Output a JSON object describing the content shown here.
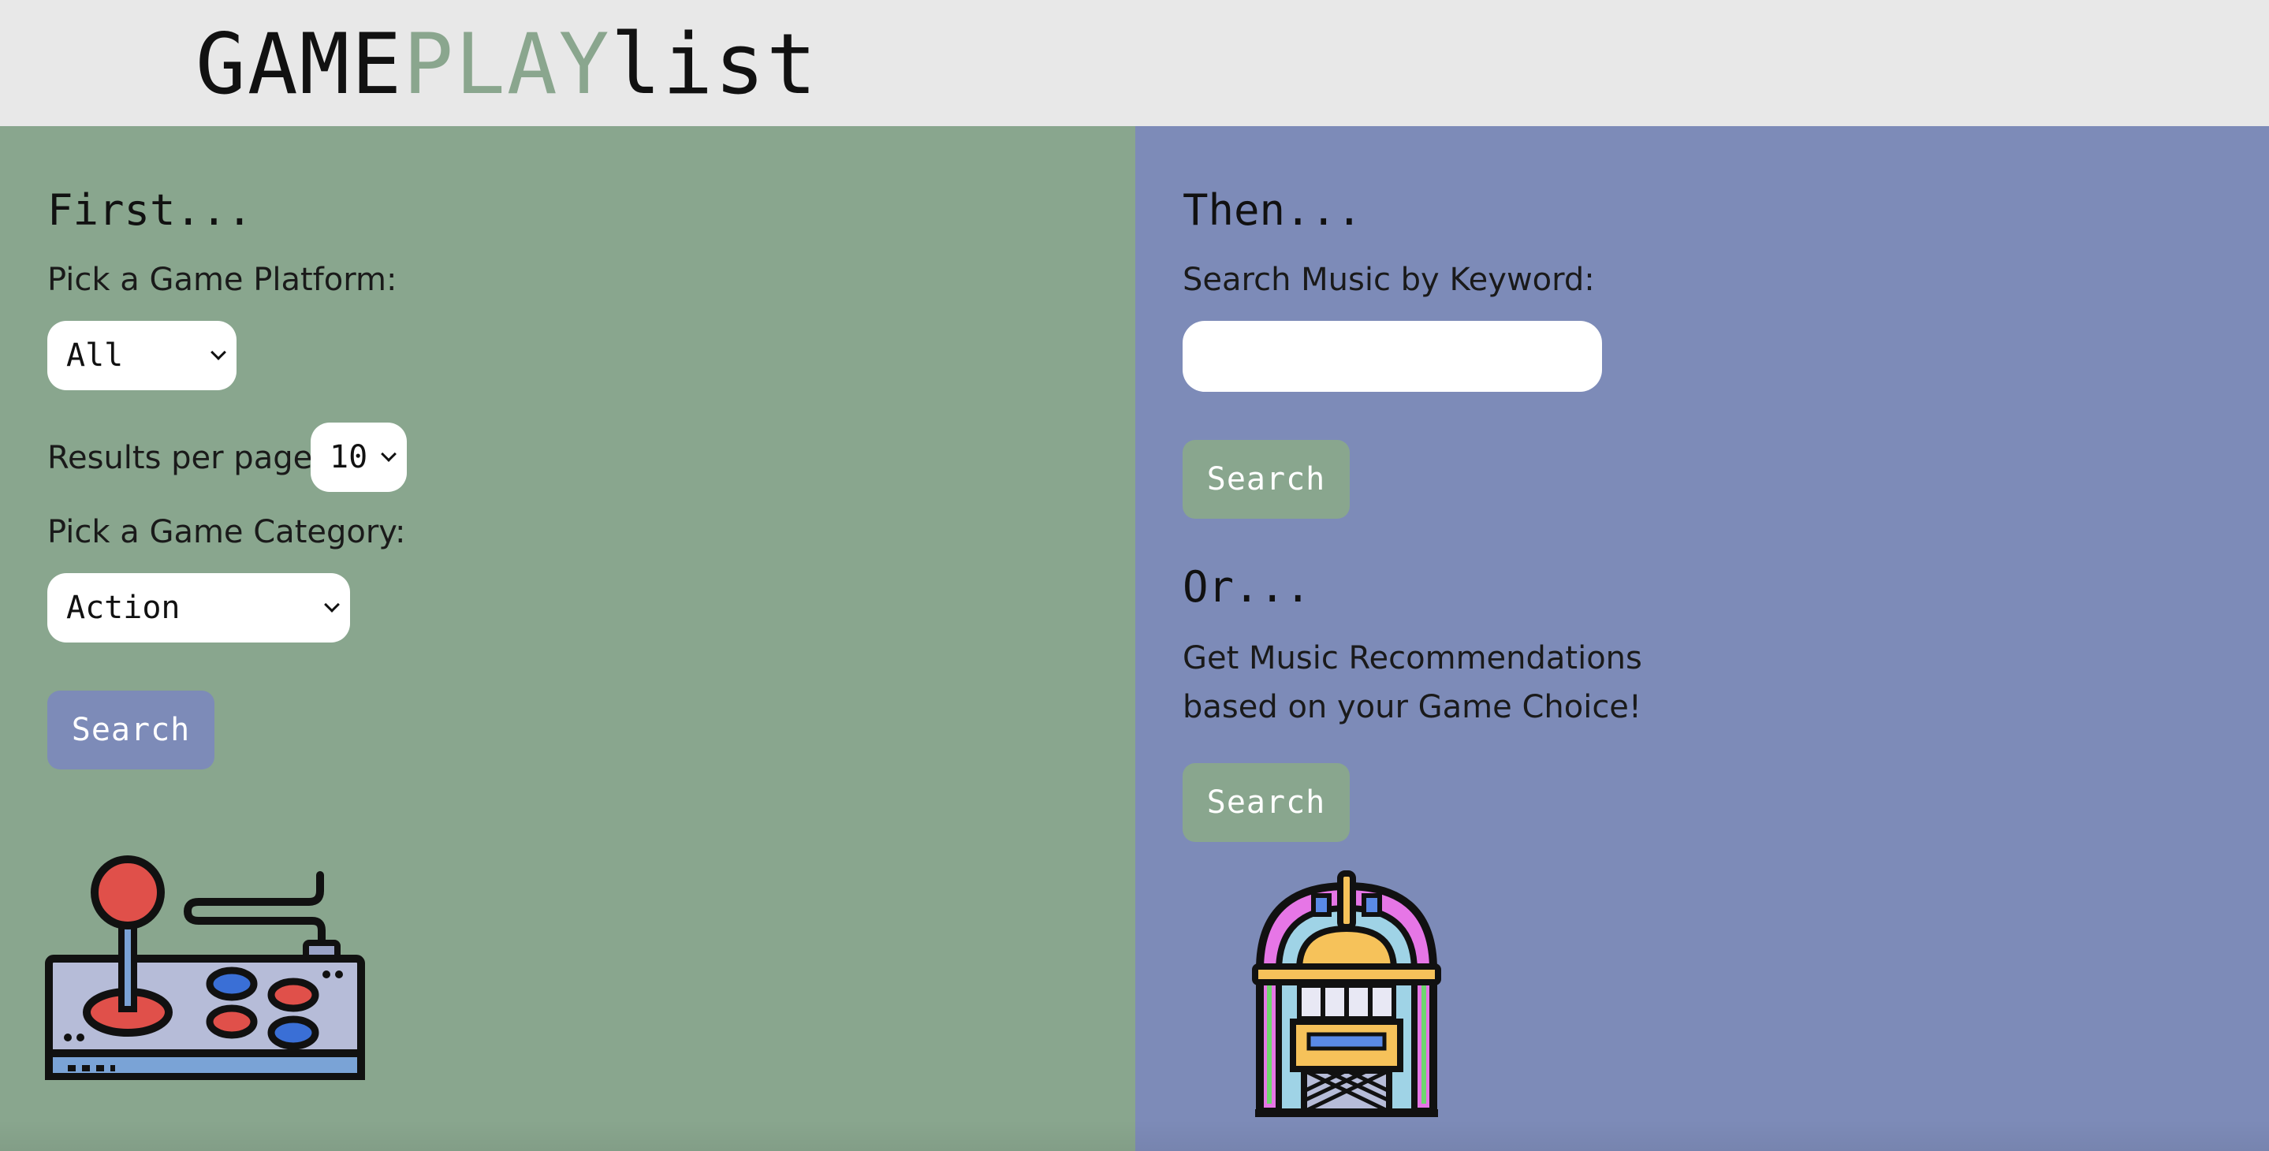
{
  "header": {
    "logo_part1": "GAME",
    "logo_part2": "PLAY",
    "logo_part3": "list"
  },
  "left_panel": {
    "heading": "First...",
    "platform_label": "Pick a Game Platform:",
    "platform_value": "All",
    "results_label": "Results per page:",
    "results_value": "10",
    "category_label": "Pick a Game Category:",
    "category_value": "Action",
    "search_button": "Search",
    "illustration_icon": "arcade-joystick-icon"
  },
  "right_panel": {
    "heading": "Then...",
    "keyword_label": "Search Music by Keyword:",
    "keyword_value": "",
    "search_button": "Search",
    "or_heading": "Or...",
    "recommend_line1": "Get Music Recommendations",
    "recommend_line2": "based on your Game Choice!",
    "recommend_button": "Search",
    "illustration_icon": "jukebox-icon"
  },
  "colors": {
    "green": "#89a68e",
    "blue": "#7d8bb8",
    "header_bg": "#e8e8e8"
  }
}
